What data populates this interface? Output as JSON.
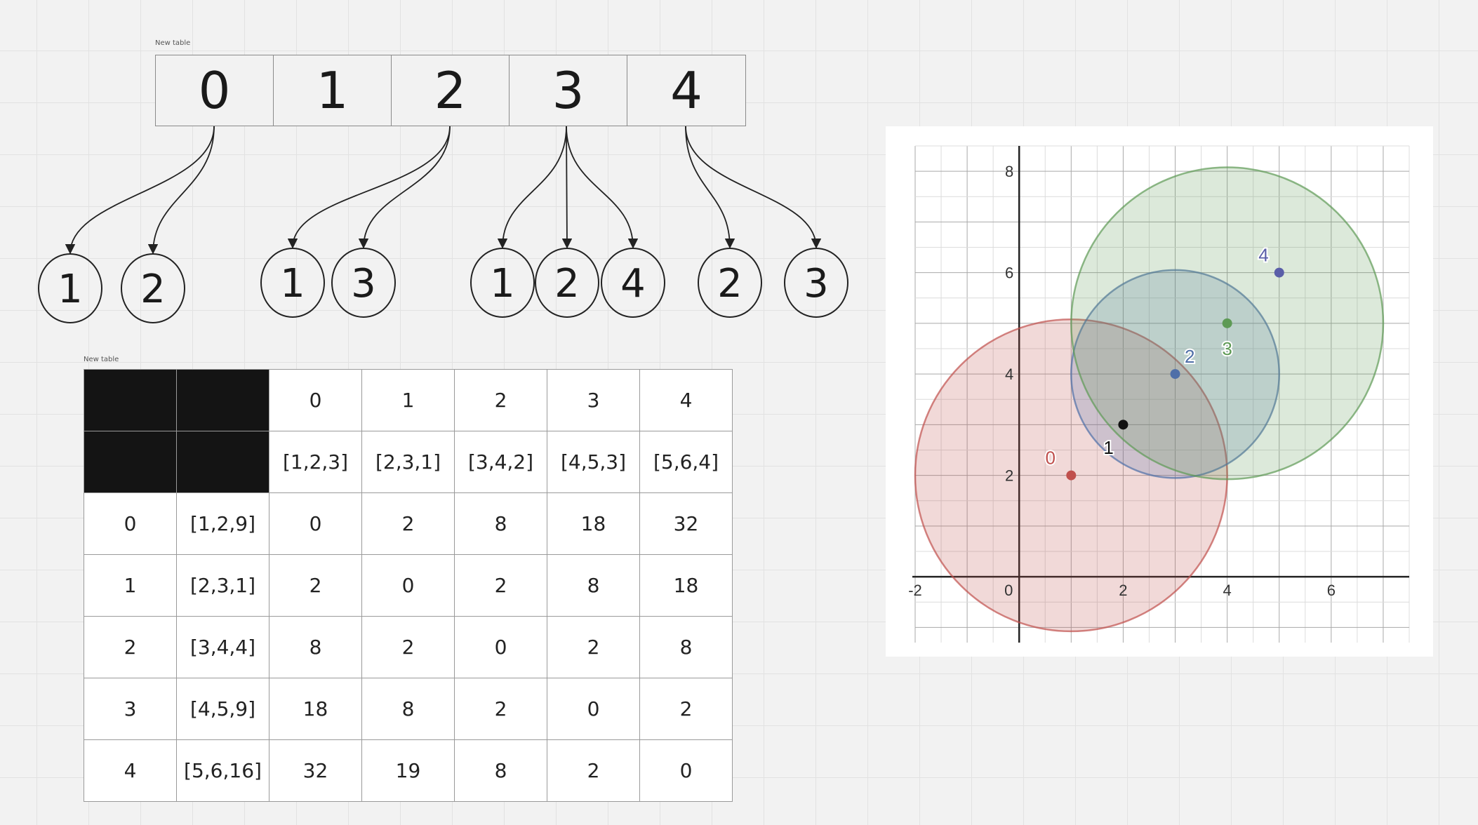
{
  "top_table": {
    "caption": "New table",
    "cells": [
      "0",
      "1",
      "2",
      "3",
      "4"
    ]
  },
  "tree": {
    "groups": [
      {
        "parent": 0,
        "children": [
          "1",
          "2"
        ]
      },
      {
        "parent": 2,
        "children": [
          "1",
          "3"
        ]
      },
      {
        "parent": 3,
        "children": [
          "1",
          "2",
          "4"
        ]
      },
      {
        "parent": 4,
        "children": [
          "2",
          "3"
        ]
      }
    ]
  },
  "matrix_table": {
    "caption": "New table",
    "header_index": [
      "0",
      "1",
      "2",
      "3",
      "4"
    ],
    "header_coords": [
      "[1,2,3]",
      "[2,3,1]",
      "[3,4,2]",
      "[4,5,3]",
      "[5,6,4]"
    ],
    "rows": [
      {
        "index": "0",
        "coord": "[1,2,9]",
        "values": [
          "0",
          "2",
          "8",
          "18",
          "32"
        ]
      },
      {
        "index": "1",
        "coord": "[2,3,1]",
        "values": [
          "2",
          "0",
          "2",
          "8",
          "18"
        ]
      },
      {
        "index": "2",
        "coord": "[3,4,4]",
        "values": [
          "8",
          "2",
          "0",
          "2",
          "8"
        ]
      },
      {
        "index": "3",
        "coord": "[4,5,9]",
        "values": [
          "18",
          "8",
          "2",
          "0",
          "2"
        ]
      },
      {
        "index": "4",
        "coord": "[5,6,16]",
        "values": [
          "32",
          "19",
          "8",
          "2",
          "0"
        ]
      }
    ]
  },
  "graph": {
    "xlim": [
      -2,
      7.5
    ],
    "ylim": [
      -1.3,
      8.5
    ],
    "x_ticks": [
      {
        "v": -2,
        "label": "-2"
      },
      {
        "v": 0,
        "label": "0"
      },
      {
        "v": 2,
        "label": "2"
      },
      {
        "v": 4,
        "label": "4"
      },
      {
        "v": 6,
        "label": "6"
      }
    ],
    "y_ticks": [
      {
        "v": 2,
        "label": "2"
      },
      {
        "v": 4,
        "label": "4"
      },
      {
        "v": 6,
        "label": "6"
      },
      {
        "v": 8,
        "label": "8"
      }
    ],
    "circles": [
      {
        "cx": 1,
        "cy": 2,
        "r": 3,
        "color": "#c0504d"
      },
      {
        "cx": 3,
        "cy": 4,
        "r": 2,
        "color": "#4f6fa8"
      },
      {
        "cx": 4,
        "cy": 5,
        "r": 3,
        "color": "#5e9a55"
      }
    ],
    "points": [
      {
        "x": 1,
        "y": 2,
        "label": "0",
        "color": "#c0504d",
        "lx": -0.4,
        "ly": 0.35
      },
      {
        "x": 2,
        "y": 3,
        "label": "1",
        "color": "#111111",
        "lx": -0.28,
        "ly": -0.45
      },
      {
        "x": 3,
        "y": 4,
        "label": "2",
        "color": "#4f6fa8",
        "lx": 0.28,
        "ly": 0.35
      },
      {
        "x": 4,
        "y": 5,
        "label": "3",
        "color": "#5e9a55",
        "lx": 0.0,
        "ly": -0.5
      },
      {
        "x": 5,
        "y": 6,
        "label": "4",
        "color": "#5a5ea8",
        "lx": -0.3,
        "ly": 0.35
      }
    ]
  }
}
